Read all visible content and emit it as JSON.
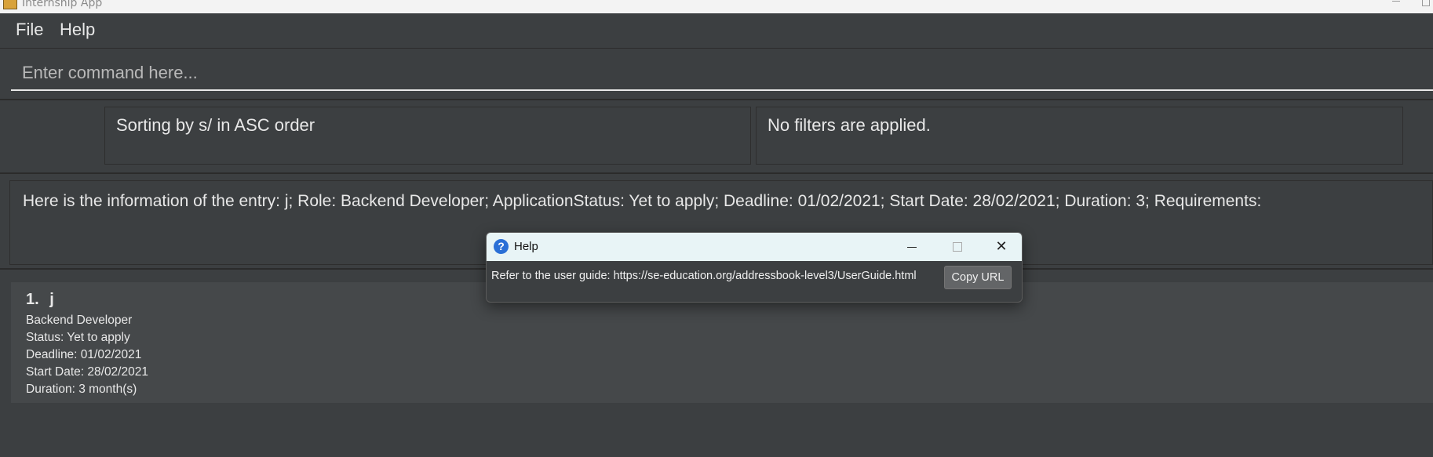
{
  "window": {
    "title": "Internship App",
    "icon": "app-icon",
    "controls": {
      "minimize_icon": "minimize-icon",
      "maximize_icon": "maximize-icon"
    }
  },
  "menu": {
    "items": [
      {
        "label": "File"
      },
      {
        "label": "Help"
      }
    ]
  },
  "command": {
    "placeholder": "Enter command here...",
    "value": ""
  },
  "status": {
    "sort_text": "Sorting by s/ in ASC order",
    "filter_text": "No filters are applied."
  },
  "result": {
    "text": "Here is the information of the entry: j; Role: Backend Developer; ApplicationStatus: Yet to apply; Deadline: 01/02/2021; Start Date: 28/02/2021; Duration: 3; Requirements:"
  },
  "list": {
    "items": [
      {
        "index": "1.",
        "name": "j",
        "role": "Backend Developer",
        "status": "Status: Yet to apply",
        "deadline": "Deadline: 01/02/2021",
        "start_date": "Start Date: 28/02/2021",
        "duration": "Duration: 3 month(s)"
      }
    ]
  },
  "help_dialog": {
    "title": "Help",
    "icon_glyph": "?",
    "message": "Refer to the user guide: https://se-education.org/addressbook-level3/UserGuide.html",
    "copy_button_label": "Copy URL",
    "close_glyph": "✕"
  },
  "colors": {
    "background": "#3c3f41",
    "card": "#45484a",
    "text": "#e8e8e8",
    "dialog_titlebar": "#e8f4f6",
    "dialog_icon": "#2a6fd6"
  }
}
